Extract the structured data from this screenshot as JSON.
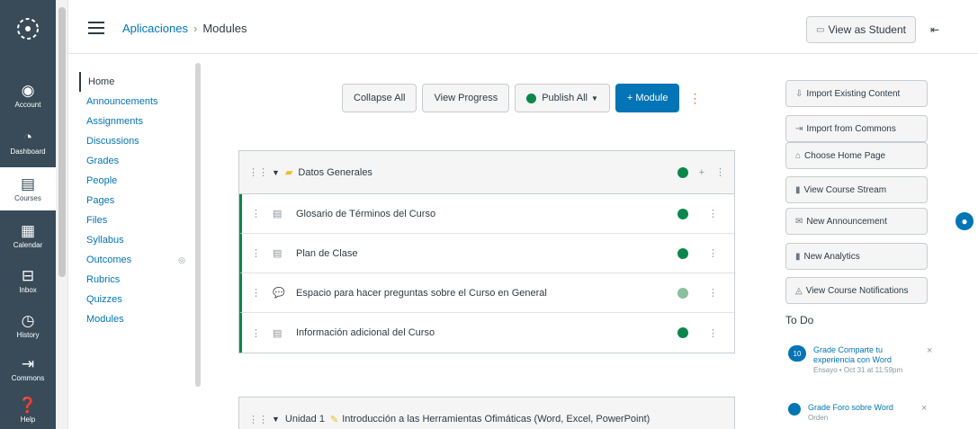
{
  "global_nav": {
    "items": [
      {
        "label": "Account",
        "icon": "user-icon"
      },
      {
        "label": "Dashboard",
        "icon": "dashboard-icon"
      },
      {
        "label": "Courses",
        "icon": "courses-icon"
      },
      {
        "label": "Calendar",
        "icon": "calendar-icon"
      },
      {
        "label": "Inbox",
        "icon": "inbox-icon"
      },
      {
        "label": "History",
        "icon": "history-icon"
      },
      {
        "label": "Commons",
        "icon": "commons-icon"
      },
      {
        "label": "Help",
        "icon": "help-icon"
      }
    ]
  },
  "header": {
    "breadcrumb_course": "Aplicaciones",
    "breadcrumb_sep": "›",
    "breadcrumb_page": "Modules",
    "view_as_student": "View as Student"
  },
  "course_nav": {
    "items": [
      "Home",
      "Announcements",
      "Assignments",
      "Discussions",
      "Grades",
      "People",
      "Pages",
      "Files",
      "Syllabus",
      "Outcomes",
      "Rubrics",
      "Quizzes",
      "Modules"
    ]
  },
  "toolbar": {
    "collapse_all": "Collapse All",
    "view_progress": "View Progress",
    "publish_all": "Publish All",
    "add_module": "+ Module"
  },
  "modules": [
    {
      "title": "Datos Generales",
      "items": [
        {
          "title": "Glosario de Términos del Curso",
          "icon": "page-icon"
        },
        {
          "title": "Plan de Clase",
          "icon": "page-icon"
        },
        {
          "title": "Espacio para hacer preguntas sobre el Curso en General",
          "icon": "discussion-icon"
        },
        {
          "title": "Información adicional del Curso",
          "icon": "page-icon"
        }
      ]
    },
    {
      "title": "Unidad 1",
      "subtitle": "Introducción a las Herramientas Ofimáticas (Word, Excel, PowerPoint)"
    }
  ],
  "sidebar": {
    "buttons": [
      "Import Existing Content",
      "Import from Commons",
      "Choose Home Page",
      "View Course Stream",
      "New Announcement",
      "New Analytics",
      "View Course Notifications"
    ],
    "todo_heading": "To Do",
    "todo": [
      {
        "badge": "10",
        "title": "Grade Comparte tu experiencia con Word",
        "sub": "Ensayo • Oct 31 at 11:59pm"
      },
      {
        "badge": "",
        "title": "Grade Foro sobre Word",
        "sub": "Orden"
      }
    ]
  },
  "colors": {
    "nav_bg": "#394b58",
    "link": "#0374b5",
    "success": "#0b874b"
  }
}
